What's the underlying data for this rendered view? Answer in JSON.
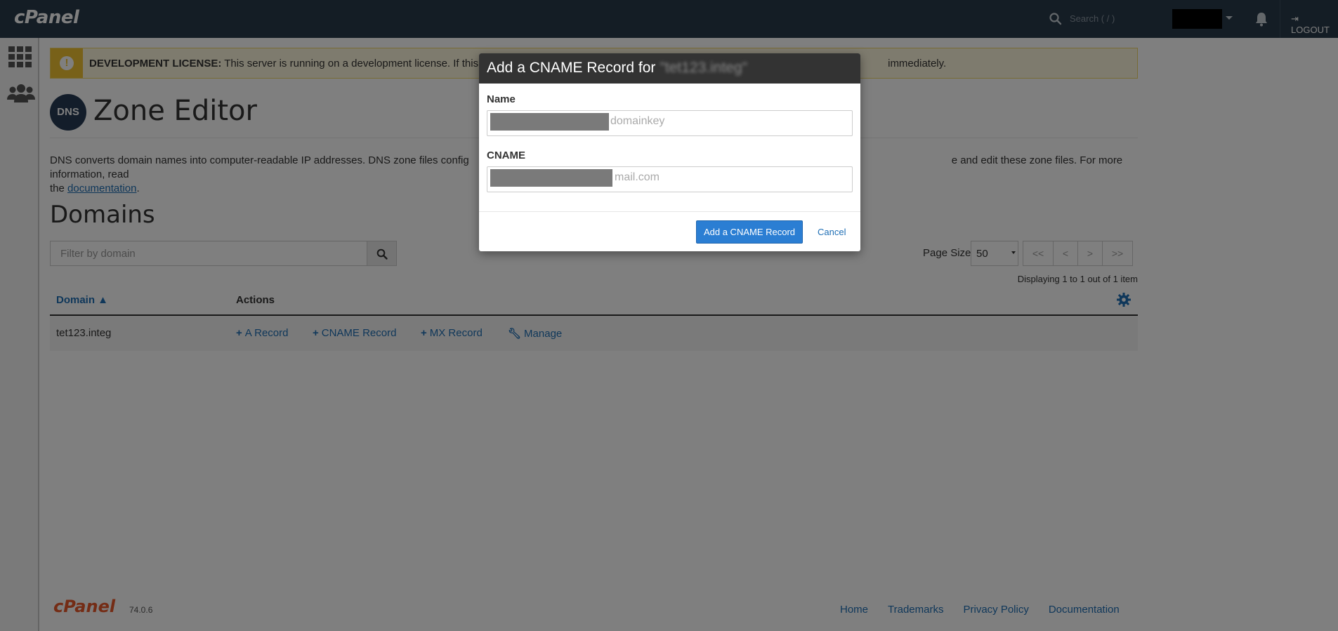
{
  "topbar": {
    "brand": "cPanel",
    "search_placeholder": "Search ( / )",
    "logout_label": "LOGOUT"
  },
  "alert": {
    "strong": "DEVELOPMENT LICENSE:",
    "text_left": " This server is running on a development license. If this",
    "text_right": "immediately."
  },
  "page": {
    "icon_label": "DNS",
    "title": "Zone Editor",
    "description_start": "DNS converts domain names into computer-readable IP addresses. DNS zone files config",
    "description_end": "e and edit these zone files. For more information, read",
    "description_line2_prefix": "the ",
    "doc_link": "documentation",
    "description_line2_suffix": "."
  },
  "domains": {
    "heading": "Domains",
    "filter_placeholder": "Filter by domain",
    "page_size_label": "Page Size",
    "page_size_value": "50",
    "pager": [
      "<<",
      "<",
      ">",
      ">>"
    ],
    "displaying": "Displaying 1 to 1 out of 1 item",
    "columns": {
      "domain": "Domain ▲",
      "actions": "Actions"
    },
    "rows": [
      {
        "domain": "tet123.integ",
        "actions": [
          "A Record",
          "CNAME Record",
          "MX Record",
          "Manage"
        ]
      }
    ]
  },
  "footer": {
    "brand": "cPanel",
    "version": "74.0.6",
    "links": [
      "Home",
      "Trademarks",
      "Privacy Policy",
      "Documentation"
    ]
  },
  "modal": {
    "title": "Add a CNAME Record for",
    "title_domain": "\"tet123.integ\"",
    "name_label": "Name",
    "name_suffix": "domainkey",
    "cname_label": "CNAME",
    "cname_suffix": "mail.com",
    "submit_label": "Add a CNAME Record",
    "cancel_label": "Cancel"
  }
}
